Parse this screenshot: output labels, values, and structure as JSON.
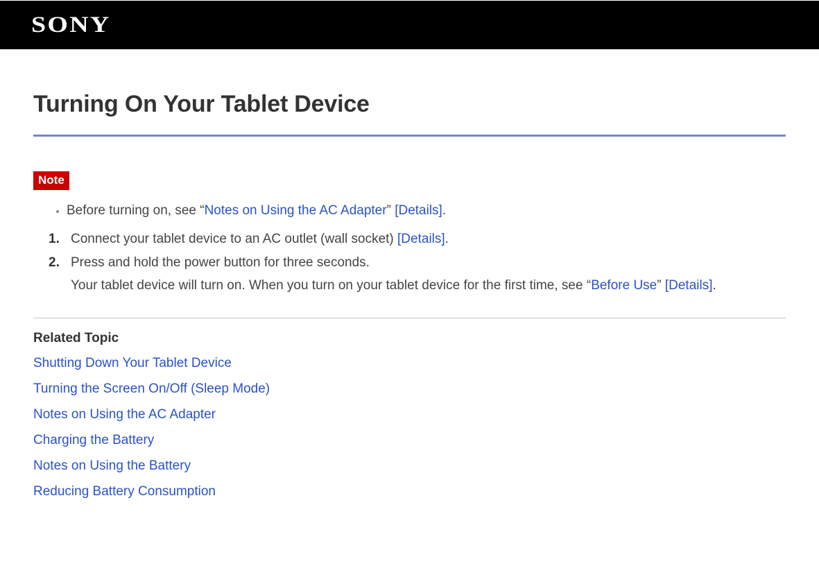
{
  "header": {
    "brand": "SONY"
  },
  "page": {
    "title": "Turning On Your Tablet Device",
    "note_label": "Note",
    "note_items": [
      {
        "pre": "Before turning on, see “",
        "link1": "Notes on Using the AC Adapter",
        "mid": "” ",
        "link2": "[Details]",
        "post": "."
      }
    ],
    "steps": [
      {
        "text_pre": "Connect your tablet device to an AC outlet (wall socket) ",
        "details": "[Details]",
        "text_post": "."
      },
      {
        "text_pre": "Press and hold the power button for three seconds.",
        "sub_pre": "Your tablet device will turn on. When you turn on your tablet device for the first time, see “",
        "sub_link1": "Before Use",
        "sub_mid": "” ",
        "sub_link2": "[Details]",
        "sub_post": "."
      }
    ],
    "related_heading": "Related Topic",
    "related": [
      "Shutting Down Your Tablet Device",
      "Turning the Screen On/Off (Sleep Mode)",
      "Notes on Using the AC Adapter",
      "Charging the Battery",
      "Notes on Using the Battery",
      "Reducing Battery Consumption"
    ]
  }
}
